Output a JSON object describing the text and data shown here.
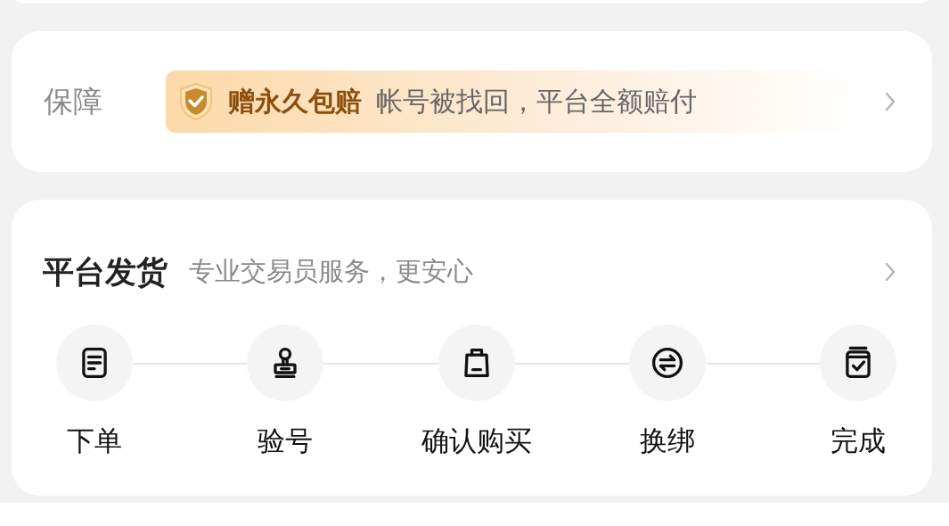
{
  "guarantee": {
    "label": "保障",
    "badge_title": "赠永久包赔",
    "badge_text": "帐号被找回，平台全额赔付"
  },
  "delivery": {
    "title": "平台发货",
    "subtitle": "专业交易员服务，更安心",
    "steps": [
      {
        "label": "下单",
        "kind": "order"
      },
      {
        "label": "验号",
        "kind": "stamp"
      },
      {
        "label": "确认购买",
        "kind": "bag"
      },
      {
        "label": "换绑",
        "kind": "exchange"
      },
      {
        "label": "完成",
        "kind": "box"
      }
    ]
  }
}
